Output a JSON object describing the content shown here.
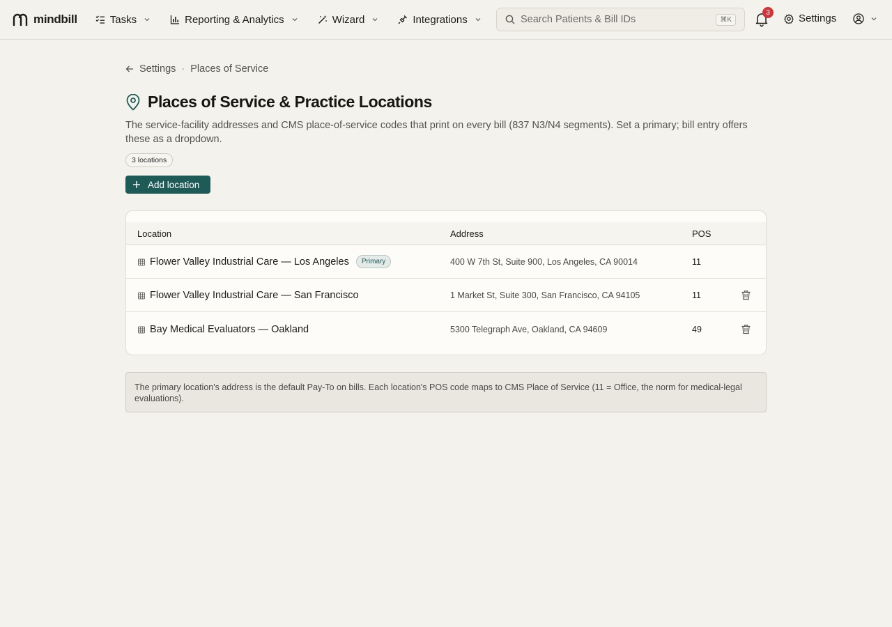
{
  "app": {
    "name": "mindbill"
  },
  "nav": {
    "items": [
      {
        "label": "Tasks",
        "icon": "tasks-icon"
      },
      {
        "label": "Reporting & Analytics",
        "icon": "chart-icon"
      },
      {
        "label": "Wizard",
        "icon": "wand-icon"
      },
      {
        "label": "Integrations",
        "icon": "plug-icon"
      }
    ]
  },
  "search": {
    "placeholder": "Search Patients & Bill IDs",
    "shortcut": "⌘K"
  },
  "notifications": {
    "count": "3"
  },
  "settings": {
    "label": "Settings"
  },
  "breadcrumb": {
    "parent": "Settings",
    "separator": "·",
    "current": "Places of Service"
  },
  "page": {
    "title": "Places of Service & Practice Locations",
    "description": "The service-facility addresses and CMS place-of-service codes that print on every bill (837 N3/N4 segments). Set a primary; bill entry offers these as a dropdown.",
    "count_label": "3 locations",
    "add_button": "Add location"
  },
  "table": {
    "headers": {
      "location": "Location",
      "address": "Address",
      "pos": "POS"
    },
    "rows": [
      {
        "name": "Flower Valley Industrial Care — Los Angeles",
        "badge": "Primary",
        "address": "400 W 7th St, Suite 900, Los Angeles, CA 90014",
        "pos": "11"
      },
      {
        "name": "Flower Valley Industrial Care — San Francisco",
        "address": "1 Market St, Suite 300, San Francisco, CA 94105",
        "pos": "11"
      },
      {
        "name": "Bay Medical Evaluators — Oakland",
        "address": "5300 Telegraph Ave, Oakland, CA 94609",
        "pos": "49"
      }
    ]
  },
  "note": {
    "text": "The primary location's address is the default Pay-To on bills. Each location's POS code maps to CMS Place of Service (11 = Office, the norm for medical-legal evaluations)."
  },
  "colors": {
    "accent": "#1e5a56",
    "badge": "#d13438",
    "background": "#f4f2ec"
  }
}
